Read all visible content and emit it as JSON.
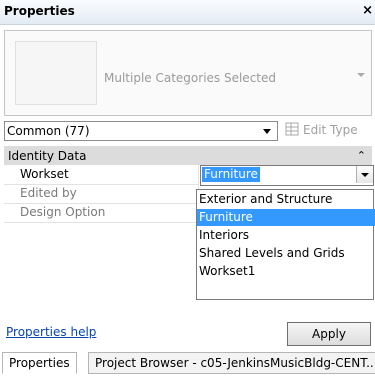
{
  "panel": {
    "title": "Properties",
    "close_symbol": "×"
  },
  "type_selector": {
    "text": "Multiple Categories Selected"
  },
  "filter": {
    "selected": "Common (77)"
  },
  "edit_type": {
    "label": "Edit Type",
    "icon": "edit-type-icon"
  },
  "grid": {
    "section_title": "Identity Data",
    "collapse_symbol": "⌃",
    "rows": [
      {
        "label": "Workset",
        "value": "Furniture"
      },
      {
        "label": "Edited by",
        "value": ""
      },
      {
        "label": "Design Option",
        "value": ""
      }
    ]
  },
  "workset_dropdown": {
    "options": [
      "Exterior and Structure",
      "Furniture",
      "Interiors",
      "Shared Levels and Grids",
      "Workset1"
    ],
    "selected_index": 1
  },
  "footer": {
    "help_link": "Properties help",
    "apply_button": "Apply"
  },
  "tabs": [
    {
      "label": "Properties",
      "active": true
    },
    {
      "label": "Project Browser - c05-JenkinsMusicBldg-CENT...",
      "active": false
    }
  ],
  "colors": {
    "selection": "#3399ff",
    "link": "#0645ad",
    "header_bg": "#dcdcdc"
  }
}
